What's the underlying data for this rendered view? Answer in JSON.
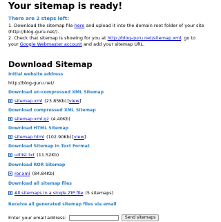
{
  "hero": {
    "title": "Your sitemap is ready!",
    "steps_intro": "There are 2 steps left:",
    "step1_pre": "1. Download the sitemap file ",
    "step1_link": "here",
    "step1_post": " and upload it into the domain root folder of your site (http://blog-guru.net/).",
    "step2_pre": "2. Check that sitemap is showing for you at ",
    "step2_link": "http://blog-guru.net/sitemap.xml",
    "step2_mid": ", go to your ",
    "step2_link2": "Google Webmaster account",
    "step2_post": " and add your sitemap URL."
  },
  "download": {
    "title": "Download Sitemap",
    "initial_label": "Initial website address",
    "initial_value": "http://blog-guru.net/",
    "sections": [
      {
        "label": "Download un-compressed XML Sitemap",
        "link": "sitemap.xml",
        "size": "(23.85Kb)",
        "extra_link": "view"
      },
      {
        "label": "Download compressed XML Sitemap",
        "link": "sitemap.xml.gz",
        "size": "(4.40Kb)"
      },
      {
        "label": "Download HTML Sitemap",
        "link": "sitemap.html",
        "size": "(102.90Kb)",
        "extra_link": "view"
      },
      {
        "label": "Download Sitemap in Text Format",
        "link": "urllist.txt",
        "size": "(11.52Kb)"
      },
      {
        "label": "Download ROR Sitemap",
        "link": "ror.xml",
        "size": "(84.84Kb)"
      },
      {
        "label": "Download all sitemap files",
        "link": "All sitemaps in a single ZIP file",
        "size": "(5 sitemaps)"
      }
    ],
    "email_section_label": "Receive all generated sitemap files via email",
    "email_label": "Enter your email address:",
    "email_placeholder": "",
    "send_button": "Send sitemaps"
  }
}
